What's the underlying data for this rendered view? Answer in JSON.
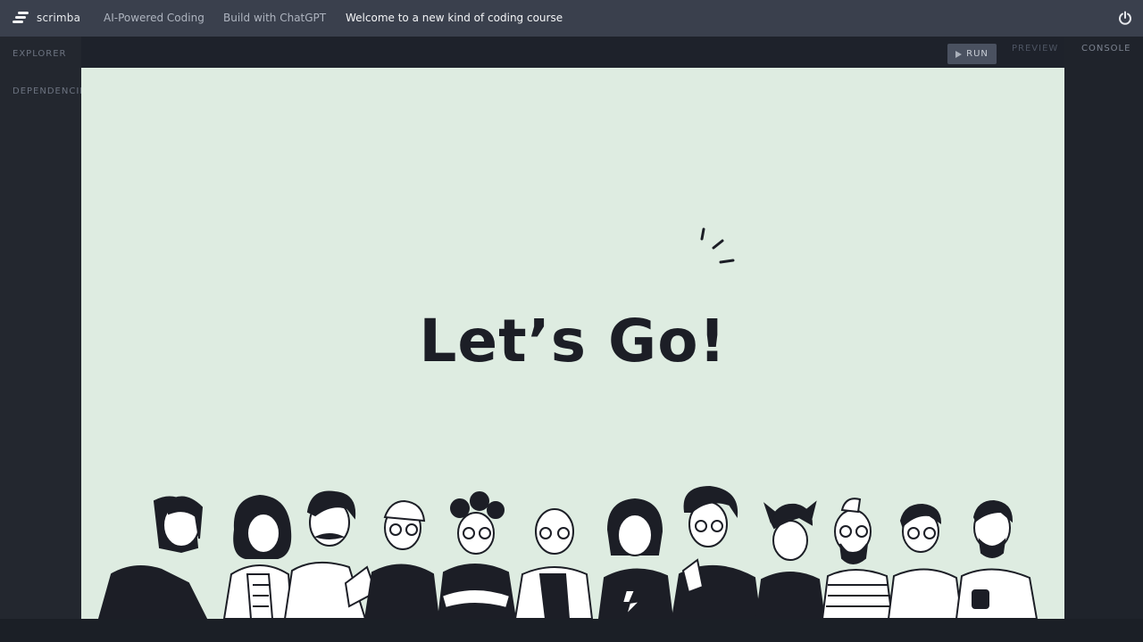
{
  "header": {
    "logo_text": "scrimba",
    "breadcrumbs": [
      "AI-Powered Coding",
      "Build with ChatGPT",
      "Welcome to a new kind of coding course"
    ],
    "power_icon": "power-icon"
  },
  "sidebar": {
    "explorer_label": "EXPLORER",
    "dependencies_label": "DEPENDENCIES"
  },
  "toolbar": {
    "run_label": "RUN",
    "preview_label": "PREVIEW",
    "console_label": "CONSOLE"
  },
  "slide": {
    "headline": "Let’s Go!",
    "illustration": "group-of-people-illustration"
  },
  "colors": {
    "topbar": "#3a404d",
    "canvas_bg": "#deece1",
    "ink": "#1c1e26"
  }
}
